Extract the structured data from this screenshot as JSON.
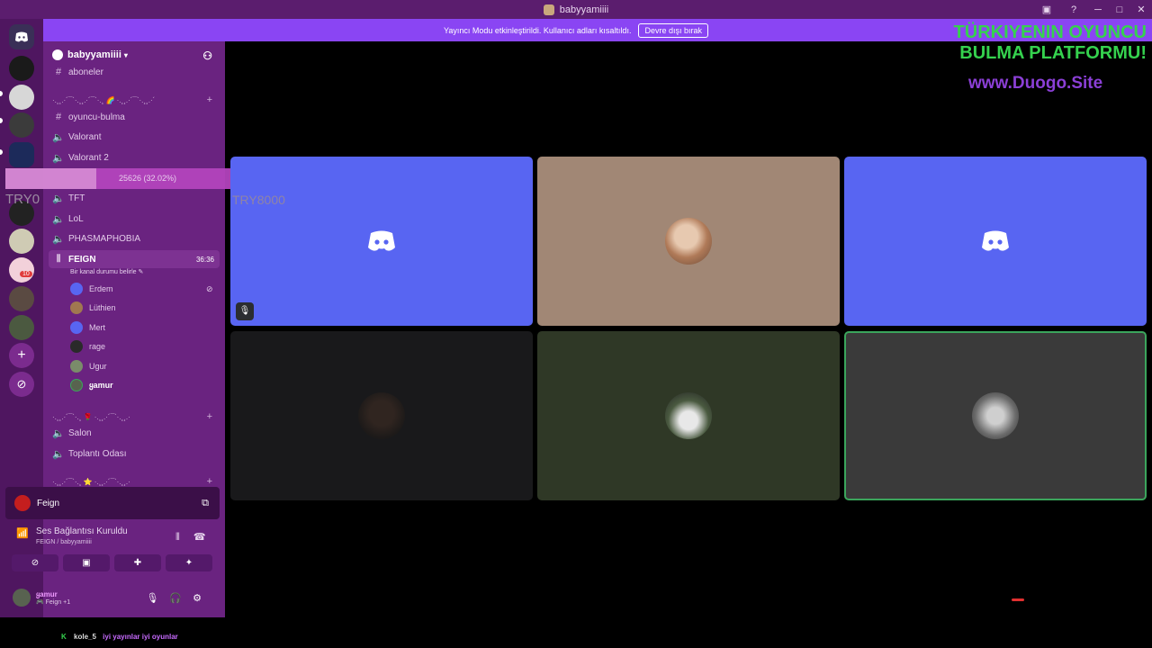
{
  "window": {
    "title": "babyyamiiii"
  },
  "banner": {
    "text": "Yayıncı Modu etkinleştirildi. Kullanıcı adları kısaltıldı.",
    "button": "Devre dışı bırak"
  },
  "guild": {
    "name": "babyyamiiii"
  },
  "channels": {
    "top_partial": "aboneler",
    "cat1": "·.¸¸.·´¯`·.¸¸.·´¯`·.¸ 🌈 ·.¸¸.·´¯`·.¸¸.·´",
    "oyuncu": "oyuncu-bulma",
    "valorant": "Valorant",
    "valorant2": "Valorant 2",
    "tft": "TFT",
    "lol": "LoL",
    "phasmo": "PHASMAPHOBIA",
    "feign": "FEIGN",
    "feign_timer": "36:36",
    "feign_status": "Bir kanal durumu belirle",
    "cat2": "·.¸¸.·´¯`·.¸ 🌹 ·.¸¸.·´¯`·.¸¸.·",
    "salon": "Salon",
    "toplanti": "Toplantı Odası",
    "cat3": "·.¸¸.·´¯`·.¸ ⭐ ·.¸¸.·´¯`·.¸¸.·"
  },
  "members": [
    "Erdem",
    "Lüthien",
    "Mert",
    "rage",
    "Ugur",
    "ყamur"
  ],
  "voice_panel": {
    "name": "Feign",
    "connection": "Ses Bağlantısı Kuruldu",
    "channel": "FEIGN / babyyamiiii"
  },
  "user": {
    "name": "ყamur",
    "status": "🎮 Feign +1"
  },
  "overlay": {
    "progress_text": "25626 (32.02%)",
    "progress_fraction": 0.3202,
    "left_tag": "TRY0",
    "tile_tag": "TRY8000",
    "ad_line1": "TÜRKIYENIN OYUNCU",
    "ad_line2": "BULMA PLATFORMU!",
    "ad_site": "www.Duogo.Site",
    "ticker_user": "kole_5",
    "ticker_msg": "iyi yayınlar iyi oyunlar"
  },
  "badges": {
    "server_mentions": "10"
  }
}
